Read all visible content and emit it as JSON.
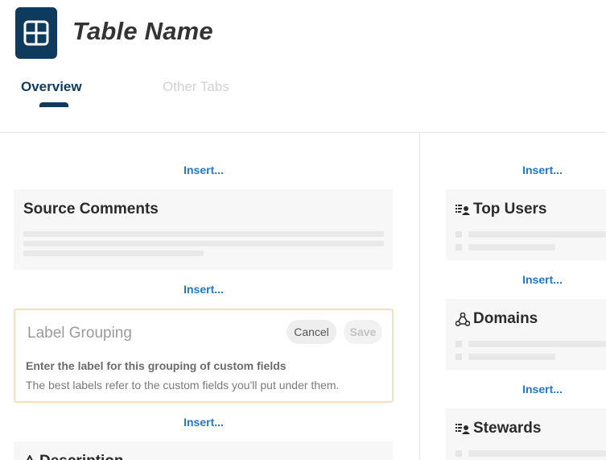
{
  "header": {
    "title": "Table Name",
    "icon": "table-grid-icon",
    "icon_color": "#0e3b5d"
  },
  "tabs": [
    {
      "label": "Overview",
      "active": true
    },
    {
      "label": "Other Tabs",
      "active": false
    }
  ],
  "insert_label": "Insert...",
  "left_column": {
    "source_comments": {
      "title": "Source Comments"
    },
    "label_grouping": {
      "placeholder": "Label Grouping",
      "cancel_label": "Cancel",
      "save_label": "Save",
      "hint_title": "Enter the label for this grouping of custom fields",
      "hint_desc": "The best labels refer to the custom fields you'll put under them."
    },
    "description": {
      "title": "Description"
    }
  },
  "right_column": {
    "top_users": {
      "title": "Top Users",
      "icon": "users-list-icon"
    },
    "domains": {
      "title": "Domains",
      "icon": "domains-icon"
    },
    "stewards": {
      "title": "Stewards",
      "icon": "stewards-list-icon"
    }
  },
  "colors": {
    "accent": "#0e3b5d",
    "link": "#1f78c8",
    "edit_border": "#f6dfc0"
  }
}
